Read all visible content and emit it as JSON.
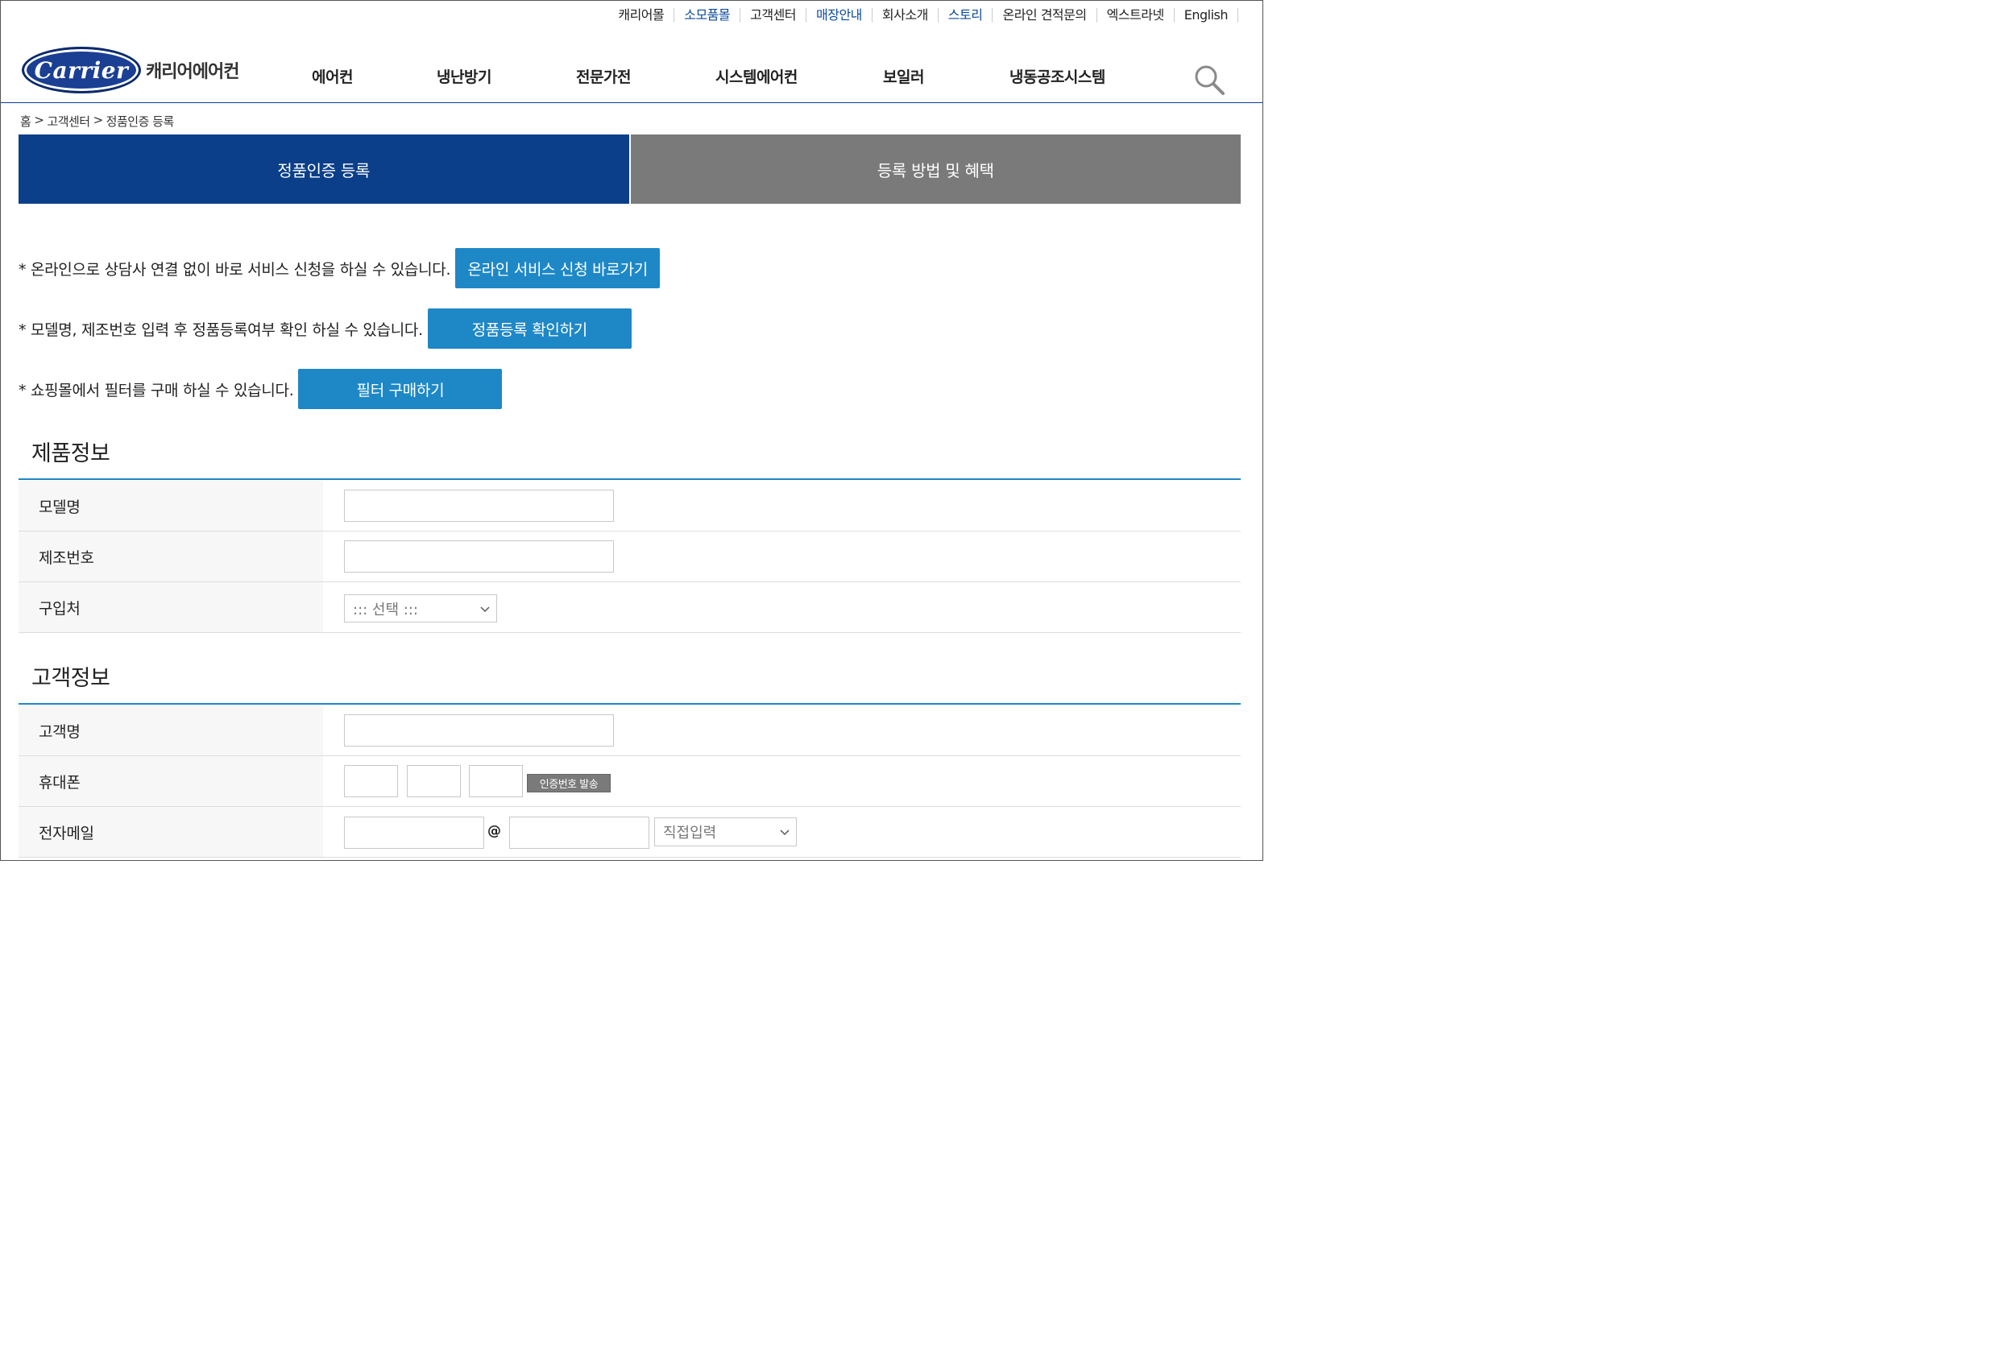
{
  "util_links": [
    {
      "label": "캐리어몰",
      "blue": false
    },
    {
      "label": "소모품몰",
      "blue": true
    },
    {
      "label": "고객센터",
      "blue": false
    },
    {
      "label": "매장안내",
      "blue": true
    },
    {
      "label": "회사소개",
      "blue": false
    },
    {
      "label": "스토리",
      "blue": true
    },
    {
      "label": "온라인 견적문의",
      "blue": false
    },
    {
      "label": "엑스트라넷",
      "blue": false
    },
    {
      "label": "English",
      "blue": false
    }
  ],
  "logo": {
    "brand": "Carrier",
    "korean": "캐리어에어컨"
  },
  "nav": [
    "에어컨",
    "냉난방기",
    "전문가전",
    "시스템에어컨",
    "보일러",
    "냉동공조시스템"
  ],
  "breadcrumb": {
    "home": "홈",
    "sep": ">",
    "level1": "고객센터",
    "level2": "정품인증 등록"
  },
  "tabs": {
    "register": "정품인증 등록",
    "guide": "등록 방법 및 혜택"
  },
  "notices": [
    {
      "text": "* 온라인으로 상담사 연결 없이 바로 서비스 신청을 하실 수 있습니다.",
      "button": "온라인 서비스 신청 바로가기"
    },
    {
      "text": "* 모델명, 제조번호 입력 후 정품등록여부 확인 하실 수 있습니다.",
      "button": "정품등록 확인하기"
    },
    {
      "text": "* 쇼핑몰에서 필터를 구매 하실 수 있습니다.",
      "button": "필터 구매하기"
    }
  ],
  "product_section": {
    "title": "제품정보",
    "model_label": "모델명",
    "serial_label": "제조번호",
    "purchase_label": "구입처",
    "purchase_selected": "::: 선택 :::"
  },
  "customer_section": {
    "title": "고객정보",
    "name_label": "고객명",
    "phone_label": "휴대폰",
    "send_code_button": "인증번호 발송",
    "email_label": "전자메일",
    "email_at": "@",
    "email_domain_selected": "직접입력"
  },
  "colors": {
    "primary_blue": "#0b3f8a",
    "accent_blue": "#1e88c7",
    "tab_gray": "#7a7a7a"
  }
}
